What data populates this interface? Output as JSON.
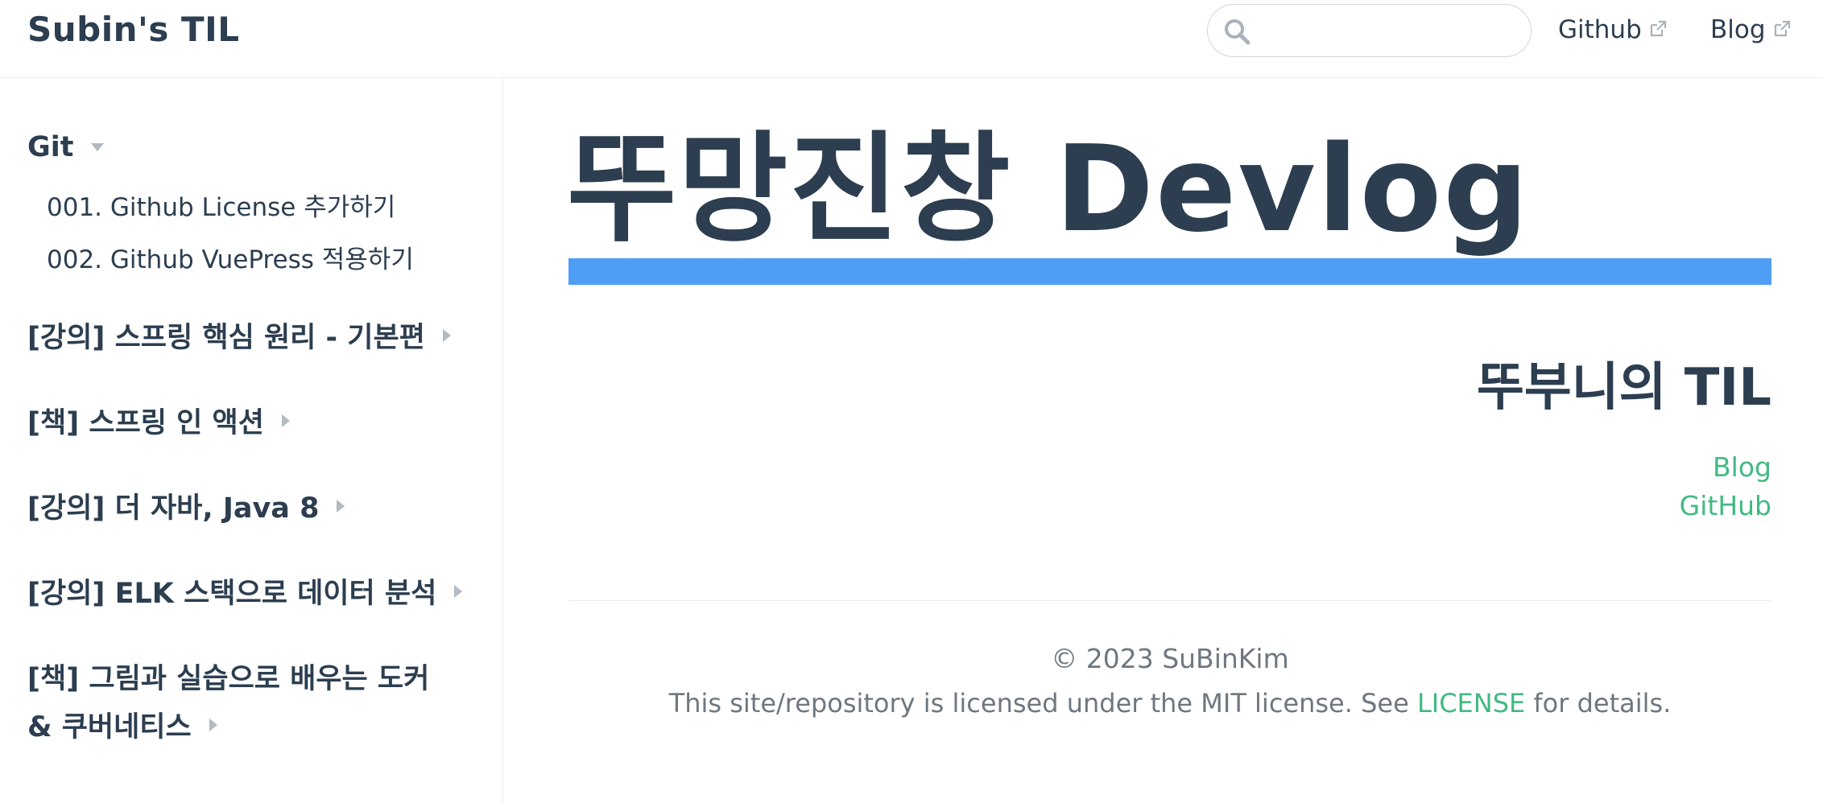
{
  "navbar": {
    "site_name": "Subin's TIL",
    "search": {
      "value": "",
      "placeholder": ""
    },
    "links": [
      {
        "label": "Github",
        "icon": "external-link-icon"
      },
      {
        "label": "Blog",
        "icon": "external-link-icon"
      }
    ]
  },
  "sidebar": {
    "groups": [
      {
        "title": "Git",
        "expanded": true,
        "items": [
          "001. Github License 추가하기",
          "002. Github VuePress 적용하기"
        ]
      },
      {
        "title": "[강의] 스프링 핵심 원리 - 기본편",
        "expanded": false
      },
      {
        "title": "[책] 스프링 인 액션",
        "expanded": false
      },
      {
        "title": "[강의] 더 자바, Java 8",
        "expanded": false
      },
      {
        "title": "[강의] ELK 스택으로 데이터 분석",
        "expanded": false
      },
      {
        "title_line1": "[책] 그림과 실습으로 배우는 도커",
        "title_line2": "& 쿠버네티스",
        "expanded": false
      }
    ]
  },
  "main": {
    "title": "뚜망진창 Devlog",
    "subtitle": "뚜부니의 TIL",
    "links": {
      "blog": "Blog",
      "github": "GitHub"
    },
    "accent_color": "#4e9ef6",
    "link_color": "#42b983"
  },
  "footer": {
    "copyright": "© 2023 SuBinKim",
    "license_prefix": "This site/repository is licensed under the MIT license. See ",
    "license_link": "LICENSE",
    "license_suffix": " for details."
  }
}
